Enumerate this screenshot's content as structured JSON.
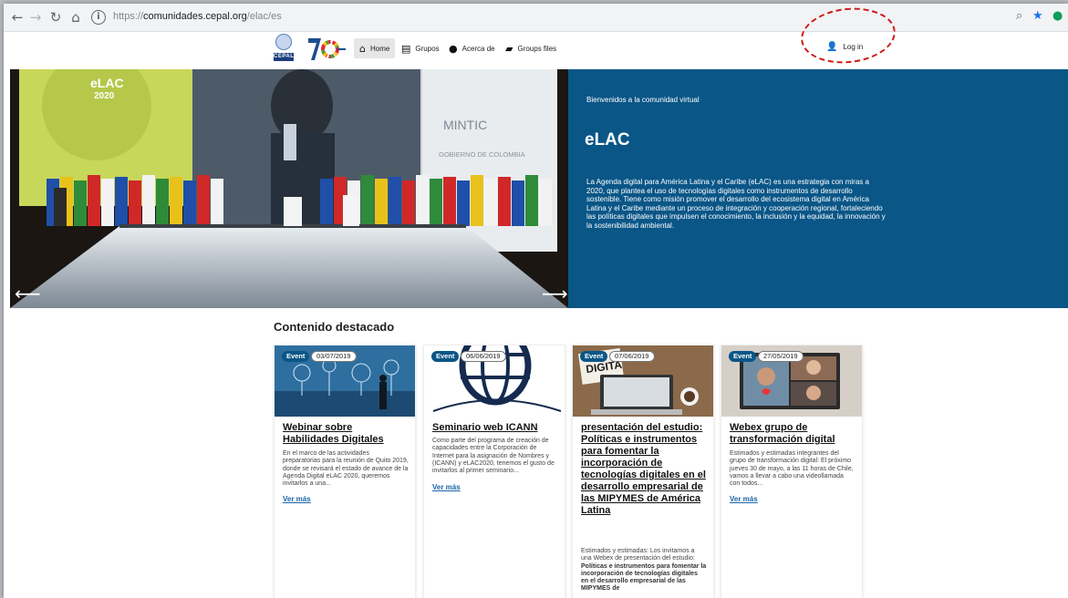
{
  "browser": {
    "url_prefix": "https://",
    "url_host": "comunidades.cepal.org",
    "url_path": "/elac/es",
    "back_icon": "arrow-left-icon",
    "forward_icon": "arrow-right-icon",
    "reload_icon": "reload-icon",
    "home_icon": "home-icon",
    "info_icon": "info-icon",
    "zoom_icon": "zoom-icon",
    "bookmark_icon": "star-icon",
    "extension_icon": "extension-icon"
  },
  "header": {
    "logo_text": "CEPAL",
    "menu": [
      {
        "label": "Home",
        "icon": "home-icon",
        "active": true
      },
      {
        "label": "Grupos",
        "icon": "groups-icon"
      },
      {
        "label": "Acerca de",
        "icon": "info-icon"
      },
      {
        "label": "Groups files",
        "icon": "files-icon"
      }
    ],
    "login_label": "Log in",
    "login_icon": "user-icon"
  },
  "hero": {
    "kicker": "Bienvenidos a la comunidad virtual",
    "title": "eLAC",
    "body": "La Agenda digital para América Latina y el Caribe (eLAC) es una estrategia con miras a 2020, que plantea el uso de tecnologías digitales como instrumentos de desarrollo sostenible. Tiene como misión promover el desarrollo del ecosistema digital en América Latina y el Caribe mediante un proceso de integración y cooperación regional, fortaleciendo las políticas digitales que impulsen el conocimiento, la inclusión y la equidad, la innovación y la sostenibilidad ambiental.",
    "image_texts": {
      "elac": "eLAC",
      "year": "2020",
      "mintic": "MINTIC",
      "gobierno": "GOBIERNO DE COLOMBIA"
    },
    "prev_label": "⟵",
    "next_label": "⟶"
  },
  "featured": {
    "title": "Contenido destacado",
    "cards": [
      {
        "badge": "Event",
        "date": "03/07/2019",
        "title": "Webinar sobre Habilidades Digitales",
        "description": "En el marco de las actividades preparatorias para la reunión de Quito 2019, donde se revisará el estado de avance de la Agenda Digital eLAC 2020, queremos invitarlos a una...",
        "link": "Ver más"
      },
      {
        "badge": "Event",
        "date": "06/06/2019",
        "title": "Seminario web ICANN",
        "description": "Como parte del programa de creación de capacidades entre la Corporación de Internet para la asignación de Nombres y (ICANN) y eLAC2020, tenemos el gusto de invitarlos al primer seminario...",
        "link": "Ver más"
      },
      {
        "badge": "Event",
        "date": "07/06/2019",
        "title": "presentación del estudio: Políticas e instrumentos para fomentar la incorporación de tecnologías digitales en el desarrollo empresarial de las MIPYMES de América Latina",
        "description_intro": "Estimados y estimadas: Los invitamos a una Webex de presentación del estudio:",
        "description_bold": "Políticas e instrumentos para fomentar la incorporación de tecnologías digitales en el desarrollo empresarial de las MIPYMES de",
        "thumb_text": "DIGITA"
      },
      {
        "badge": "Event",
        "date": "27/05/2019",
        "title": "Webex grupo de transformación digital",
        "description": "Estimados y estimadas integrantes del grupo de transformación digital: El próximo jueves 30 de mayo, a las 11 horas de Chile, vamos a llevar a cabo una videollamada con todos...",
        "link": "Ver más"
      }
    ]
  }
}
